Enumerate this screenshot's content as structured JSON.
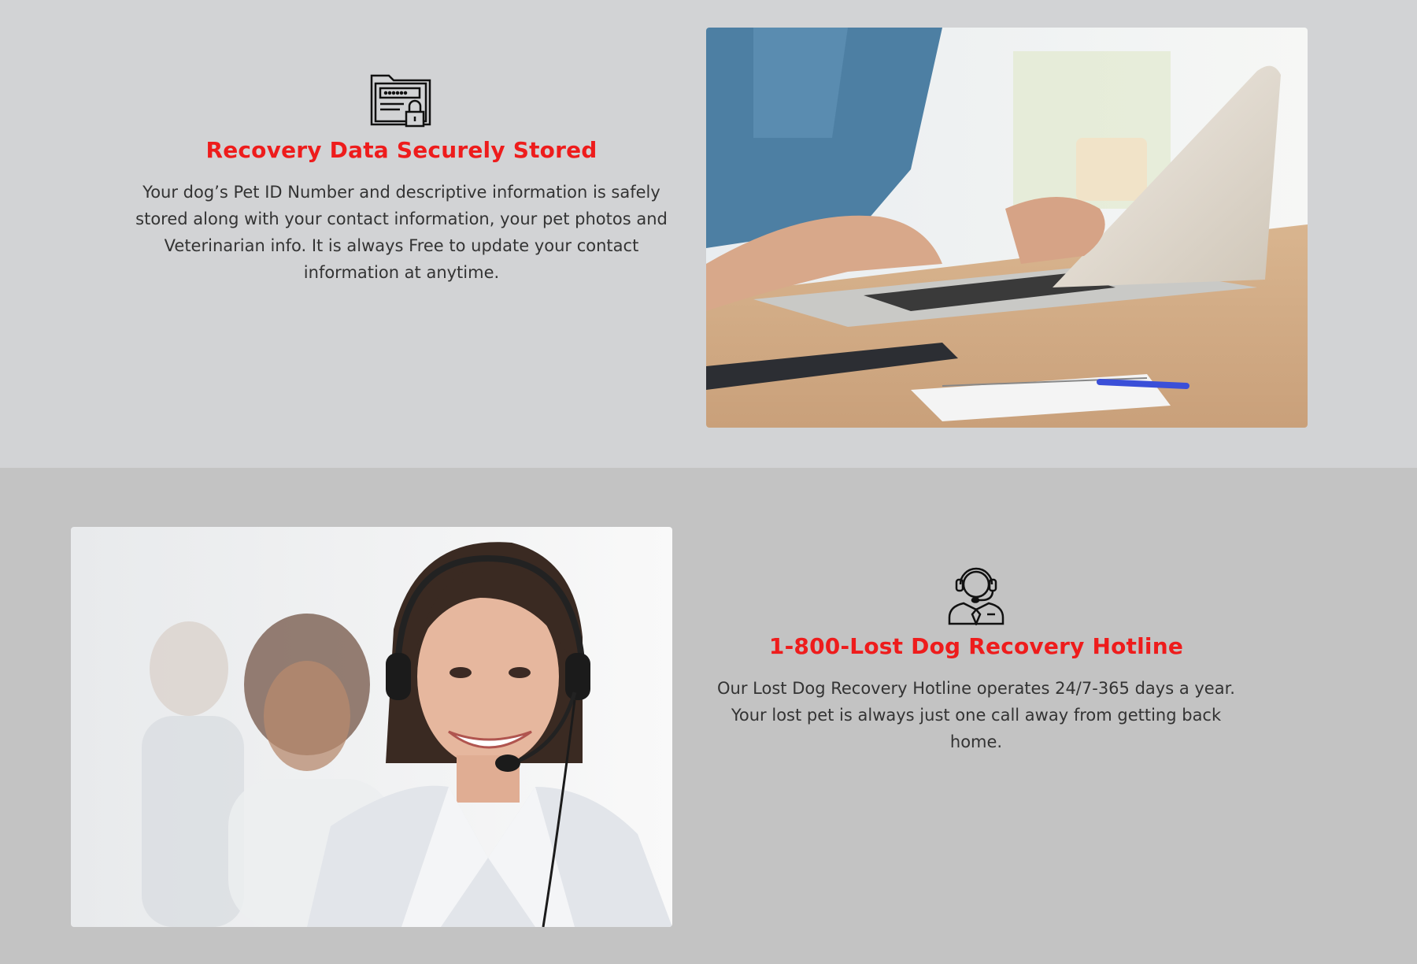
{
  "sections": [
    {
      "icon": "secure-folder-lock-icon",
      "title": "Recovery Data Securely Stored",
      "body": "Your dog’s Pet ID Number and descriptive information is safely stored along with your contact information, your pet photos and Veterinarian info. It is always Free to update your contact information at anytime.",
      "photo": "person-typing-on-laptop-photo"
    },
    {
      "icon": "headset-agent-icon",
      "title": "1-800-Lost Dog Recovery Hotline",
      "body": "Our Lost Dog Recovery Hotline operates 24/7-365 days a year. Your lost pet is always just one call away from getting back home.",
      "photo": "call-center-agent-photo"
    }
  ],
  "colors": {
    "accent": "#ee1c1c",
    "section1_bg": "#d2d3d5",
    "section2_bg": "#c3c3c3",
    "body_text": "#333333"
  }
}
